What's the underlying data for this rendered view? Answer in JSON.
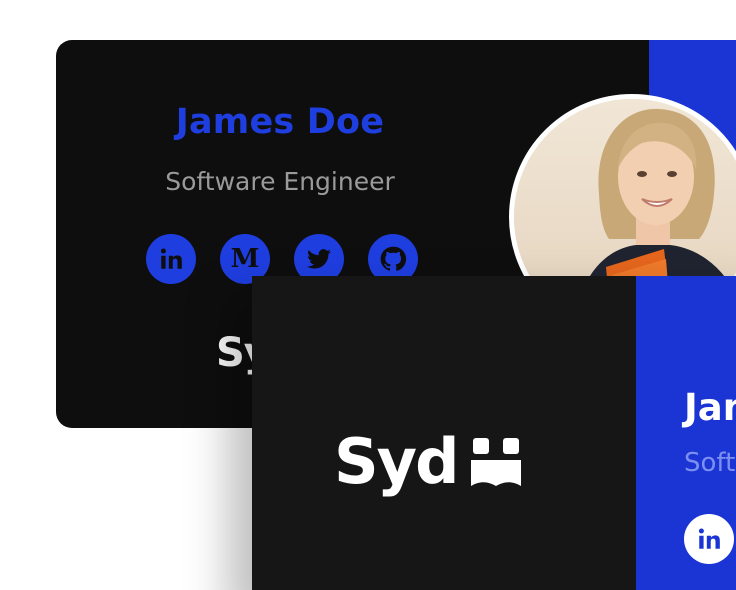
{
  "back_card": {
    "name": "James Doe",
    "role": "Software Engineer",
    "logo_text": "Syd",
    "socials": [
      {
        "icon": "linkedin-icon"
      },
      {
        "icon": "medium-icon",
        "glyph": "M"
      },
      {
        "icon": "twitter-icon"
      },
      {
        "icon": "github-icon"
      }
    ]
  },
  "front_card": {
    "logo_text": "Syd",
    "name": "James Doe",
    "role": "Software Engineer",
    "social_icon": "linkedin-icon"
  },
  "colors": {
    "accent_blue": "#1a35d4",
    "name_blue": "#1f3ee0",
    "dark": "#0e0e0e",
    "muted_text": "#9a9a9a"
  }
}
